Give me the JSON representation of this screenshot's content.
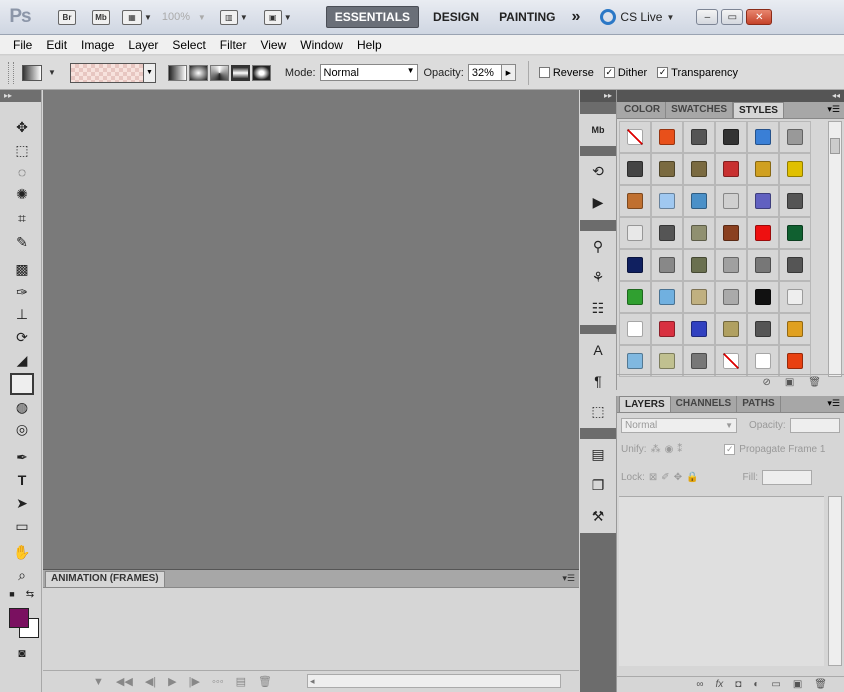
{
  "app": {
    "logo": "Ps",
    "bridge": "Br",
    "minibridge": "Mb",
    "zoom": "100%",
    "workspaces": [
      "ESSENTIALS",
      "DESIGN",
      "PAINTING"
    ],
    "more": "»",
    "cslive": "CS Live"
  },
  "menu": [
    "File",
    "Edit",
    "Image",
    "Layer",
    "Select",
    "Filter",
    "View",
    "Window",
    "Help"
  ],
  "options": {
    "mode_label": "Mode:",
    "mode_value": "Normal",
    "opacity_label": "Opacity:",
    "opacity_value": "32%",
    "reverse": "Reverse",
    "dither": "Dither",
    "transparency": "Transparency"
  },
  "colors": {
    "foreground": "#7a1060",
    "background": "#ffffff"
  },
  "animation": {
    "tab": "ANIMATION (FRAMES)"
  },
  "styles_panel": {
    "tabs": [
      "COLOR",
      "SWATCHES",
      "STYLES"
    ],
    "active_tab": "STYLES",
    "swatches": [
      "#ffffff",
      "#e8501a",
      "#555555",
      "#333333",
      "#3a7fd6",
      "#999999",
      "#444444",
      "#7a6a40",
      "#7a6a40",
      "#c83030",
      "#d0a020",
      "#e0c000",
      "#c07030",
      "#a0c8f0",
      "#4a90c8",
      "#d0d0d0",
      "#6060c0",
      "#555555",
      "#e8e8e8",
      "#555555",
      "#909070",
      "#8a4020",
      "#ee1010",
      "#106030",
      "#102060",
      "#888888",
      "#6a7050",
      "#a0a0a0",
      "#777777",
      "#555555",
      "#30a030",
      "#70b0e0",
      "#c0b080",
      "#aaaaaa",
      "#111111",
      "#eeeeee",
      "#ffffff",
      "#d83040",
      "#3040c0",
      "#b0a060",
      "#555555",
      "#e0a020",
      "#80b8e0",
      "#c0c090",
      "#777777",
      "#704010",
      "#ffffff",
      "#e84010"
    ]
  },
  "layers_panel": {
    "tabs": [
      "LAYERS",
      "CHANNELS",
      "PATHS"
    ],
    "active_tab": "LAYERS",
    "blend_mode": "Normal",
    "opacity_label": "Opacity:",
    "unify_label": "Unify:",
    "propagate": "Propagate Frame 1",
    "lock_label": "Lock:",
    "fill_label": "Fill:"
  }
}
